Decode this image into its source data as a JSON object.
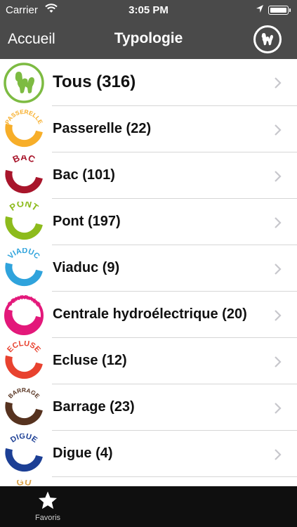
{
  "status_bar": {
    "carrier": "Carrier",
    "time": "3:05 PM"
  },
  "nav": {
    "back_label": "Accueil",
    "title": "Typologie",
    "logo_icon": "n-silhouette-logo-icon"
  },
  "colors": {
    "bar": "#4a4a4a",
    "tabbar": "#0f0f0f",
    "separator": "#d6d6d6",
    "chevron": "#c7c7cc"
  },
  "rows": [
    {
      "label": "Tous (316)",
      "icon_text": "",
      "color": "#7dbb42",
      "icon": "n-silhouette-ring-icon"
    },
    {
      "label": "Passerelle (22)",
      "icon_text": "PASSERELLE",
      "color": "#f7ae29",
      "icon": "passerelle-ring-icon"
    },
    {
      "label": "Bac (101)",
      "icon_text": "BAC",
      "color": "#a8152b",
      "icon": "bac-ring-icon"
    },
    {
      "label": "Pont (197)",
      "icon_text": "PONT",
      "color": "#8dbb1c",
      "icon": "pont-ring-icon"
    },
    {
      "label": "Viaduc (9)",
      "icon_text": "VIADUC",
      "color": "#2fa3dc",
      "icon": "viaduc-ring-icon"
    },
    {
      "label": "Centrale hydroélectrique (20)",
      "icon_text": "CENTRALE",
      "icon_text2": "HYDROELECTRIQUE",
      "color": "#e3187a",
      "icon": "centrale-ring-icon"
    },
    {
      "label": "Ecluse (12)",
      "icon_text": "ECLUSE",
      "color": "#e8422f",
      "icon": "ecluse-ring-icon"
    },
    {
      "label": "Barrage (23)",
      "icon_text": "BARRAGE",
      "color": "#56321f",
      "icon": "barrage-ring-icon"
    },
    {
      "label": "Digue (4)",
      "icon_text": "DIGUE",
      "color": "#1c3f95",
      "icon": "digue-ring-icon"
    },
    {
      "label": "",
      "icon_text": "GU",
      "color": "#d9a24a",
      "icon": "partial-ring-icon"
    }
  ],
  "tabbar": {
    "tabs": [
      {
        "label": "Favoris",
        "icon": "star-icon"
      }
    ]
  }
}
